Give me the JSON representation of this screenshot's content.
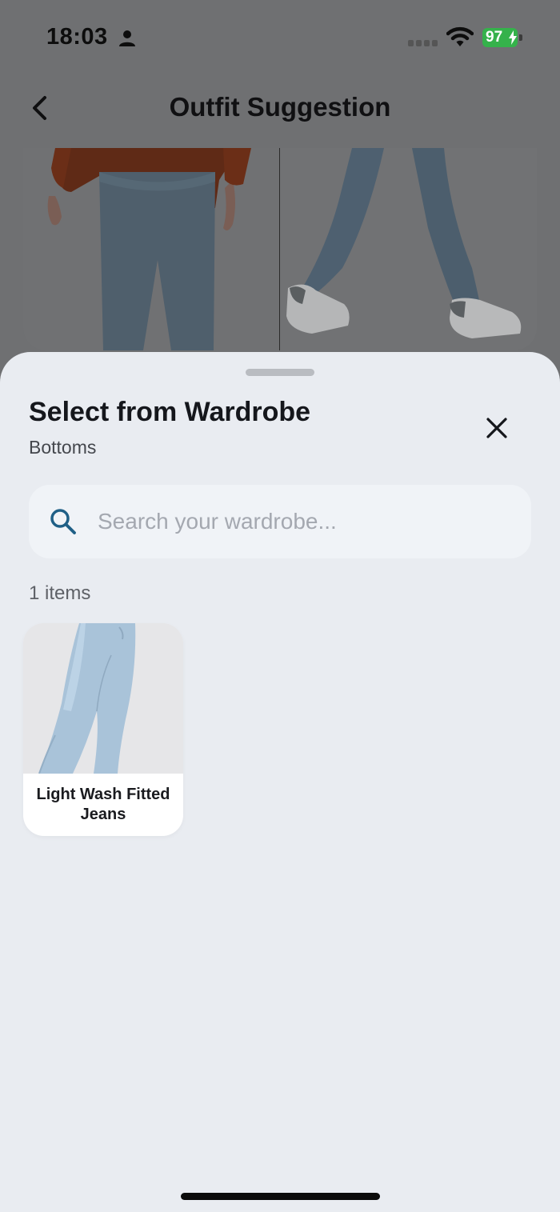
{
  "status_bar": {
    "time": "18:03",
    "battery_level": "97",
    "battery_color": "#35b24b"
  },
  "nav": {
    "title": "Outfit Suggestion",
    "back_icon": "chevron-left-icon"
  },
  "sheet": {
    "title": "Select from Wardrobe",
    "subtitle": "Bottoms",
    "close_icon": "close-icon",
    "search": {
      "placeholder": "Search your wardrobe...",
      "value": ""
    },
    "item_count_label": "1 items",
    "items": [
      {
        "name": "Light Wash Fitted Jeans",
        "image": "light-wash-jeans-photo"
      }
    ]
  },
  "colors": {
    "sheet_background": "#e9ecf1",
    "search_icon": "#1f5f86",
    "dim_overlay": "#6f7072"
  }
}
